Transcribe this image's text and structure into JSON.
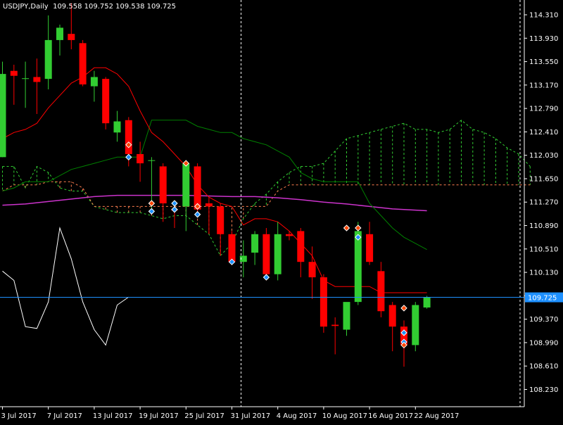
{
  "header": {
    "symbol": "USDJPY,Daily",
    "ohlc": "109.558 109.752 109.538 109.725"
  },
  "colors": {
    "background": "#000000",
    "bull": "#32CD32",
    "bear": "#FF0000",
    "axis": "#FFFFFF",
    "tenkan": "#FF0000",
    "kijun": "#008000",
    "chikou": "#FFFFFF",
    "span_a": "#32CD32",
    "span_b": "#FF7F50",
    "moving_average": "#CC33CC",
    "bid_line": "#1E90FF",
    "price_tag_bg": "#1E90FF"
  },
  "chart_data": {
    "type": "candlestick",
    "symbol": "USDJPY",
    "timeframe": "Daily",
    "ylim": [
      107.95,
      114.55
    ],
    "y_ticks": [
      "114.310",
      "113.930",
      "113.550",
      "113.170",
      "112.790",
      "112.410",
      "112.030",
      "111.650",
      "111.270",
      "110.890",
      "110.510",
      "110.130",
      "109.750",
      "109.370",
      "108.990",
      "108.610",
      "108.230"
    ],
    "x_ticks": [
      {
        "label": "3 Jul 2017",
        "bar": 0
      },
      {
        "label": "7 Jul 2017",
        "bar": 4
      },
      {
        "label": "13 Jul 2017",
        "bar": 8
      },
      {
        "label": "19 Jul 2017",
        "bar": 12
      },
      {
        "label": "25 Jul 2017",
        "bar": 16
      },
      {
        "label": "31 Jul 2017",
        "bar": 20
      },
      {
        "label": "4 Aug 2017",
        "bar": 24
      },
      {
        "label": "10 Aug 2017",
        "bar": 28
      },
      {
        "label": "16 Aug 2017",
        "bar": 32
      },
      {
        "label": "22 Aug 2017",
        "bar": 36
      }
    ],
    "current_price": "109.725",
    "vline_bar": 20.8,
    "candles": [
      {
        "o": 112.0,
        "h": 113.55,
        "l": 112.0,
        "c": 113.35
      },
      {
        "o": 113.4,
        "h": 113.5,
        "l": 112.85,
        "c": 113.32
      },
      {
        "o": 113.28,
        "h": 113.55,
        "l": 112.8,
        "c": 113.28
      },
      {
        "o": 113.3,
        "h": 113.6,
        "l": 112.7,
        "c": 113.22
      },
      {
        "o": 113.27,
        "h": 114.3,
        "l": 113.1,
        "c": 113.9
      },
      {
        "o": 113.9,
        "h": 114.15,
        "l": 113.65,
        "c": 114.1
      },
      {
        "o": 114.0,
        "h": 114.5,
        "l": 113.75,
        "c": 113.9
      },
      {
        "o": 113.85,
        "h": 113.9,
        "l": 113.15,
        "c": 113.18
      },
      {
        "o": 113.15,
        "h": 113.4,
        "l": 112.9,
        "c": 113.3
      },
      {
        "o": 113.27,
        "h": 113.3,
        "l": 112.45,
        "c": 112.55
      },
      {
        "o": 112.4,
        "h": 112.75,
        "l": 112.25,
        "c": 112.58
      },
      {
        "o": 112.6,
        "h": 112.65,
        "l": 111.85,
        "c": 112.05
      },
      {
        "o": 112.05,
        "h": 112.25,
        "l": 111.6,
        "c": 111.9
      },
      {
        "o": 111.95,
        "h": 112.0,
        "l": 111.1,
        "c": 111.95
      },
      {
        "o": 111.85,
        "h": 111.9,
        "l": 110.95,
        "c": 111.25
      },
      {
        "o": 111.15,
        "h": 111.3,
        "l": 110.85,
        "c": 111.14
      },
      {
        "o": 111.2,
        "h": 111.95,
        "l": 110.8,
        "c": 111.9
      },
      {
        "o": 111.85,
        "h": 111.9,
        "l": 111.05,
        "c": 111.15
      },
      {
        "o": 111.25,
        "h": 111.35,
        "l": 110.75,
        "c": 111.2
      },
      {
        "o": 111.2,
        "h": 111.25,
        "l": 110.4,
        "c": 110.75
      },
      {
        "o": 110.75,
        "h": 110.8,
        "l": 110.25,
        "c": 110.3
      },
      {
        "o": 110.3,
        "h": 110.65,
        "l": 110.05,
        "c": 110.4
      },
      {
        "o": 110.45,
        "h": 110.8,
        "l": 110.25,
        "c": 110.75
      },
      {
        "o": 110.75,
        "h": 110.85,
        "l": 110.0,
        "c": 110.1
      },
      {
        "o": 110.1,
        "h": 110.95,
        "l": 110.0,
        "c": 110.75
      },
      {
        "o": 110.75,
        "h": 110.8,
        "l": 110.65,
        "c": 110.72
      },
      {
        "o": 110.8,
        "h": 110.85,
        "l": 110.05,
        "c": 110.3
      },
      {
        "o": 110.3,
        "h": 110.55,
        "l": 109.7,
        "c": 110.05
      },
      {
        "o": 110.05,
        "h": 110.1,
        "l": 109.15,
        "c": 109.25
      },
      {
        "o": 109.28,
        "h": 109.4,
        "l": 108.8,
        "c": 109.26
      },
      {
        "o": 109.2,
        "h": 109.55,
        "l": 109.1,
        "c": 109.65
      },
      {
        "o": 109.65,
        "h": 110.95,
        "l": 109.6,
        "c": 110.8
      },
      {
        "o": 110.75,
        "h": 110.95,
        "l": 110.25,
        "c": 110.3
      },
      {
        "o": 110.15,
        "h": 110.3,
        "l": 109.4,
        "c": 109.5
      },
      {
        "o": 109.6,
        "h": 109.65,
        "l": 108.85,
        "c": 109.25
      },
      {
        "o": 109.25,
        "h": 109.35,
        "l": 108.6,
        "c": 108.95
      },
      {
        "o": 108.95,
        "h": 109.65,
        "l": 108.85,
        "c": 109.6
      },
      {
        "o": 109.56,
        "h": 109.75,
        "l": 109.54,
        "c": 109.73
      }
    ],
    "tenkan": [
      [
        0,
        112.3
      ],
      [
        1,
        112.4
      ],
      [
        2,
        112.45
      ],
      [
        3,
        112.55
      ],
      [
        4,
        112.8
      ],
      [
        5,
        113.0
      ],
      [
        6,
        113.2
      ],
      [
        7,
        113.3
      ],
      [
        8,
        113.45
      ],
      [
        9,
        113.45
      ],
      [
        10,
        113.35
      ],
      [
        11,
        113.15
      ],
      [
        12,
        112.75
      ],
      [
        13,
        112.4
      ],
      [
        14,
        112.25
      ],
      [
        15,
        112.05
      ],
      [
        16,
        111.85
      ],
      [
        17,
        111.55
      ],
      [
        18,
        111.35
      ],
      [
        19,
        111.25
      ],
      [
        20,
        111.2
      ],
      [
        21,
        110.9
      ],
      [
        22,
        111.0
      ],
      [
        23,
        111.0
      ],
      [
        24,
        110.95
      ],
      [
        25,
        110.8
      ],
      [
        26,
        110.6
      ],
      [
        27,
        110.4
      ],
      [
        28,
        110.0
      ],
      [
        29,
        109.9
      ],
      [
        30,
        109.9
      ],
      [
        31,
        109.9
      ],
      [
        32,
        109.9
      ],
      [
        33,
        109.8
      ],
      [
        34,
        109.8
      ],
      [
        35,
        109.8
      ],
      [
        36,
        109.8
      ],
      [
        37,
        109.8
      ]
    ],
    "kijun": [
      [
        0,
        111.45
      ],
      [
        1,
        111.5
      ],
      [
        2,
        111.6
      ],
      [
        3,
        111.6
      ],
      [
        4,
        111.6
      ],
      [
        5,
        111.7
      ],
      [
        6,
        111.8
      ],
      [
        7,
        111.85
      ],
      [
        8,
        111.9
      ],
      [
        9,
        111.95
      ],
      [
        10,
        112.0
      ],
      [
        11,
        112.0
      ],
      [
        12,
        112.0
      ],
      [
        13,
        112.6
      ],
      [
        14,
        112.6
      ],
      [
        15,
        112.6
      ],
      [
        16,
        112.6
      ],
      [
        17,
        112.5
      ],
      [
        18,
        112.45
      ],
      [
        19,
        112.4
      ],
      [
        20,
        112.4
      ],
      [
        21,
        112.3
      ],
      [
        22,
        112.25
      ],
      [
        23,
        112.2
      ],
      [
        24,
        112.1
      ],
      [
        25,
        112.0
      ],
      [
        26,
        111.75
      ],
      [
        27,
        111.65
      ],
      [
        28,
        111.6
      ],
      [
        29,
        111.6
      ],
      [
        30,
        111.6
      ],
      [
        31,
        111.6
      ],
      [
        32,
        111.25
      ],
      [
        33,
        111.05
      ],
      [
        34,
        110.85
      ],
      [
        35,
        110.7
      ],
      [
        36,
        110.6
      ],
      [
        37,
        110.5
      ]
    ],
    "span_a": [
      [
        0,
        111.85
      ],
      [
        1,
        111.85
      ],
      [
        2,
        111.5
      ],
      [
        3,
        111.85
      ],
      [
        4,
        111.75
      ],
      [
        5,
        111.5
      ],
      [
        6,
        111.45
      ],
      [
        7,
        111.45
      ],
      [
        8,
        111.2
      ],
      [
        9,
        111.15
      ],
      [
        10,
        111.1
      ],
      [
        11,
        111.1
      ],
      [
        12,
        111.1
      ],
      [
        13,
        111.05
      ],
      [
        14,
        111.0
      ],
      [
        15,
        111.05
      ],
      [
        16,
        111.05
      ],
      [
        17,
        110.9
      ],
      [
        18,
        110.75
      ],
      [
        19,
        110.4
      ],
      [
        20,
        110.6
      ],
      [
        21,
        111.0
      ],
      [
        22,
        111.25
      ],
      [
        23,
        111.4
      ],
      [
        24,
        111.6
      ],
      [
        25,
        111.75
      ],
      [
        26,
        111.85
      ],
      [
        27,
        111.85
      ],
      [
        28,
        111.9
      ],
      [
        29,
        112.1
      ],
      [
        30,
        112.3
      ],
      [
        31,
        112.35
      ],
      [
        32,
        112.4
      ],
      [
        33,
        112.45
      ],
      [
        34,
        112.5
      ],
      [
        35,
        112.55
      ],
      [
        36,
        112.45
      ],
      [
        37,
        112.45
      ],
      [
        38,
        112.4
      ],
      [
        39,
        112.45
      ],
      [
        40,
        112.6
      ],
      [
        41,
        112.45
      ],
      [
        42,
        112.4
      ],
      [
        43,
        112.3
      ],
      [
        44,
        112.15
      ],
      [
        45,
        112.05
      ],
      [
        46,
        111.85
      ]
    ],
    "span_b": [
      [
        0,
        111.45
      ],
      [
        1,
        111.55
      ],
      [
        2,
        111.55
      ],
      [
        3,
        111.55
      ],
      [
        4,
        111.6
      ],
      [
        5,
        111.6
      ],
      [
        6,
        111.6
      ],
      [
        7,
        111.5
      ],
      [
        8,
        111.2
      ],
      [
        9,
        111.2
      ],
      [
        10,
        111.2
      ],
      [
        11,
        111.2
      ],
      [
        12,
        111.2
      ],
      [
        13,
        111.2
      ],
      [
        14,
        111.2
      ],
      [
        15,
        111.2
      ],
      [
        16,
        111.2
      ],
      [
        17,
        111.2
      ],
      [
        18,
        111.2
      ],
      [
        19,
        111.2
      ],
      [
        20,
        111.2
      ],
      [
        21,
        111.2
      ],
      [
        22,
        111.2
      ],
      [
        23,
        111.2
      ],
      [
        24,
        111.45
      ],
      [
        25,
        111.55
      ],
      [
        26,
        111.55
      ],
      [
        27,
        111.55
      ],
      [
        28,
        111.55
      ],
      [
        29,
        111.55
      ],
      [
        30,
        111.55
      ],
      [
        31,
        111.55
      ],
      [
        32,
        111.55
      ],
      [
        33,
        111.55
      ],
      [
        34,
        111.55
      ],
      [
        35,
        111.55
      ],
      [
        36,
        111.55
      ],
      [
        37,
        111.55
      ],
      [
        38,
        111.55
      ],
      [
        39,
        111.55
      ],
      [
        40,
        111.55
      ],
      [
        41,
        111.55
      ],
      [
        42,
        111.55
      ],
      [
        43,
        111.55
      ],
      [
        44,
        111.55
      ],
      [
        45,
        111.55
      ],
      [
        46,
        111.55
      ]
    ],
    "chikou": [
      [
        0,
        110.15
      ],
      [
        1,
        110.0
      ],
      [
        2,
        109.25
      ],
      [
        3,
        109.22
      ],
      [
        4,
        109.65
      ],
      [
        5,
        110.85
      ],
      [
        6,
        110.35
      ],
      [
        7,
        109.65
      ],
      [
        8,
        109.2
      ],
      [
        9,
        108.95
      ],
      [
        10,
        109.6
      ],
      [
        11,
        109.73
      ]
    ],
    "moving_average": [
      [
        0,
        111.22
      ],
      [
        2,
        111.24
      ],
      [
        4,
        111.28
      ],
      [
        6,
        111.32
      ],
      [
        8,
        111.36
      ],
      [
        10,
        111.38
      ],
      [
        12,
        111.38
      ],
      [
        14,
        111.38
      ],
      [
        16,
        111.38
      ],
      [
        18,
        111.37
      ],
      [
        20,
        111.36
      ],
      [
        22,
        111.36
      ],
      [
        24,
        111.34
      ],
      [
        26,
        111.31
      ],
      [
        28,
        111.27
      ],
      [
        30,
        111.24
      ],
      [
        32,
        111.2
      ],
      [
        34,
        111.16
      ],
      [
        36,
        111.14
      ],
      [
        37,
        111.13
      ]
    ],
    "markers": [
      {
        "bar": 11,
        "price": 112.2,
        "kind": "down"
      },
      {
        "bar": 11,
        "price": 112.0,
        "kind": "up"
      },
      {
        "bar": 13,
        "price": 111.25,
        "kind": "down"
      },
      {
        "bar": 13,
        "price": 111.12,
        "kind": "up"
      },
      {
        "bar": 15,
        "price": 111.25,
        "kind": "up"
      },
      {
        "bar": 15,
        "price": 111.15,
        "kind": "up"
      },
      {
        "bar": 16,
        "price": 111.9,
        "kind": "down"
      },
      {
        "bar": 17,
        "price": 111.2,
        "kind": "down"
      },
      {
        "bar": 17,
        "price": 111.07,
        "kind": "up"
      },
      {
        "bar": 20,
        "price": 110.3,
        "kind": "up"
      },
      {
        "bar": 23,
        "price": 110.05,
        "kind": "up"
      },
      {
        "bar": 30,
        "price": 110.85,
        "kind": "down"
      },
      {
        "bar": 31,
        "price": 110.85,
        "kind": "down"
      },
      {
        "bar": 31,
        "price": 110.7,
        "kind": "up"
      },
      {
        "bar": 35,
        "price": 109.55,
        "kind": "down"
      },
      {
        "bar": 35,
        "price": 109.15,
        "kind": "up"
      },
      {
        "bar": 35,
        "price": 109.0,
        "kind": "up"
      },
      {
        "bar": 35,
        "price": 108.95,
        "kind": "down"
      }
    ]
  }
}
